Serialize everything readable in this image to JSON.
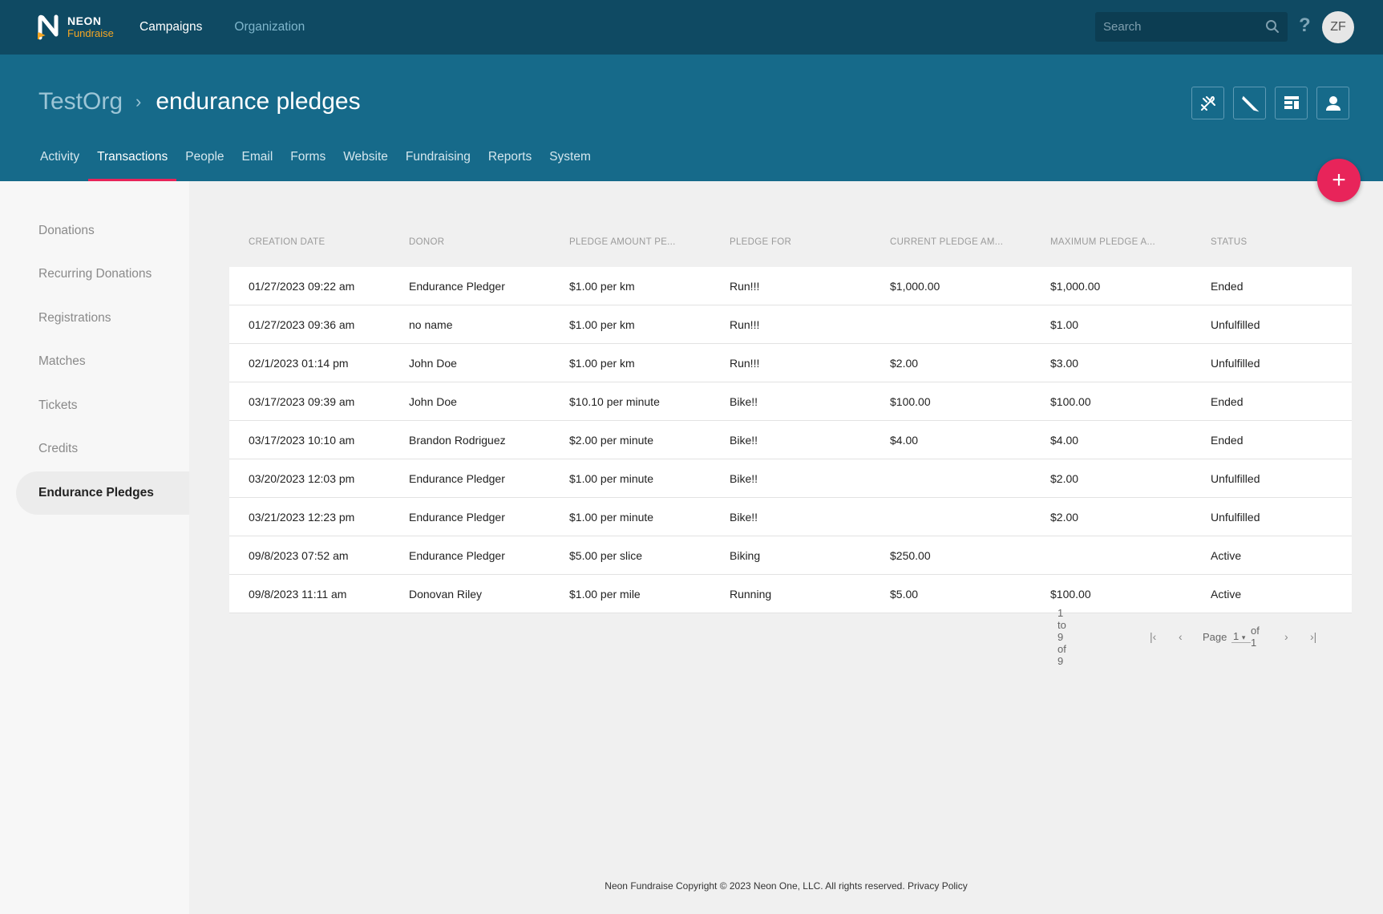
{
  "brand": {
    "line1": "NEON",
    "line2": "Fundraise",
    "accent": "#f5a623"
  },
  "topnav": {
    "campaigns": "Campaigns",
    "organization": "Organization"
  },
  "search": {
    "placeholder": "Search"
  },
  "help": "?",
  "avatar": "ZF",
  "breadcrumb": {
    "org": "TestOrg",
    "separator": "›",
    "current": "endurance pledges"
  },
  "tabs": [
    "Activity",
    "Transactions",
    "People",
    "Email",
    "Forms",
    "Website",
    "Fundraising",
    "Reports",
    "System"
  ],
  "active_tab": "Transactions",
  "fab": "+",
  "sidebar": {
    "items": [
      "Donations",
      "Recurring Donations",
      "Registrations",
      "Matches",
      "Tickets",
      "Credits",
      "Endurance Pledges"
    ],
    "active": "Endurance Pledges"
  },
  "table": {
    "headers": [
      "CREATION DATE",
      "DONOR",
      "PLEDGE AMOUNT PE...",
      "PLEDGE FOR",
      "CURRENT PLEDGE AM...",
      "MAXIMUM PLEDGE A...",
      "STATUS"
    ],
    "rows": [
      [
        "01/27/2023 09:22 am",
        "Endurance Pledger",
        "$1.00 per km",
        "Run!!!",
        "$1,000.00",
        "$1,000.00",
        "Ended"
      ],
      [
        "01/27/2023 09:36 am",
        "no name",
        "$1.00 per km",
        "Run!!!",
        "",
        "$1.00",
        "Unfulfilled"
      ],
      [
        "02/1/2023 01:14 pm",
        "John Doe",
        "$1.00 per km",
        "Run!!!",
        "$2.00",
        "$3.00",
        "Unfulfilled"
      ],
      [
        "03/17/2023 09:39 am",
        "John Doe",
        "$10.10 per minute",
        "Bike!!",
        "$100.00",
        "$100.00",
        "Ended"
      ],
      [
        "03/17/2023 10:10 am",
        "Brandon Rodriguez",
        "$2.00 per minute",
        "Bike!!",
        "$4.00",
        "$4.00",
        "Ended"
      ],
      [
        "03/20/2023 12:03 pm",
        "Endurance Pledger",
        "$1.00 per minute",
        "Bike!!",
        "",
        "$2.00",
        "Unfulfilled"
      ],
      [
        "03/21/2023 12:23 pm",
        "Endurance Pledger",
        "$1.00 per minute",
        "Bike!!",
        "",
        "$2.00",
        "Unfulfilled"
      ],
      [
        "09/8/2023 07:52 am",
        "Endurance Pledger",
        "$5.00 per slice",
        "Biking",
        "$250.00",
        "",
        "Active"
      ],
      [
        "09/8/2023 11:11 am",
        "Donovan Riley",
        "$1.00 per mile",
        "Running",
        "$5.00",
        "$100.00",
        "Active"
      ]
    ]
  },
  "pagination": {
    "summary": "1 to 9 of 9",
    "page_label": "Page",
    "page_value": "1",
    "of_label": "of 1"
  },
  "footer": {
    "copyright": "Neon Fundraise Copyright © 2023 Neon One, LLC. All rights reserved.",
    "privacy": "Privacy Policy"
  },
  "colors": {
    "topbar": "#0f4a63",
    "header": "#166a8a",
    "accent": "#e8245a"
  },
  "icons": {
    "tools": [
      "tools-icon",
      "pen-icon",
      "layout-icon",
      "user-icon"
    ]
  }
}
